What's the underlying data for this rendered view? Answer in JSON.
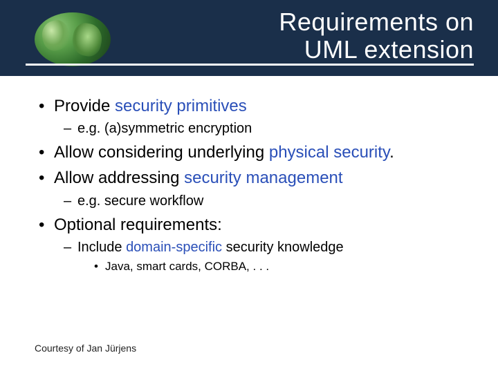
{
  "title_line1": "Requirements on",
  "title_line2": "UML extension",
  "bullets": {
    "b1": {
      "pre": "Provide ",
      "link": "security primitives"
    },
    "b1_sub": "e.g. (a)symmetric encryption",
    "b2": {
      "pre": "Allow considering underlying ",
      "link": "physical security",
      "post": "."
    },
    "b3": {
      "pre": "Allow addressing ",
      "link": "security management"
    },
    "b3_sub": "e.g. secure workflow",
    "b4": "Optional requirements:",
    "b4_sub": {
      "pre": "Include ",
      "link": "domain-specific",
      "post": " security knowledge"
    },
    "b4_sub_sub": "Java, smart cards, CORBA, . . ."
  },
  "footer": "Courtesy of Jan Jürjens"
}
